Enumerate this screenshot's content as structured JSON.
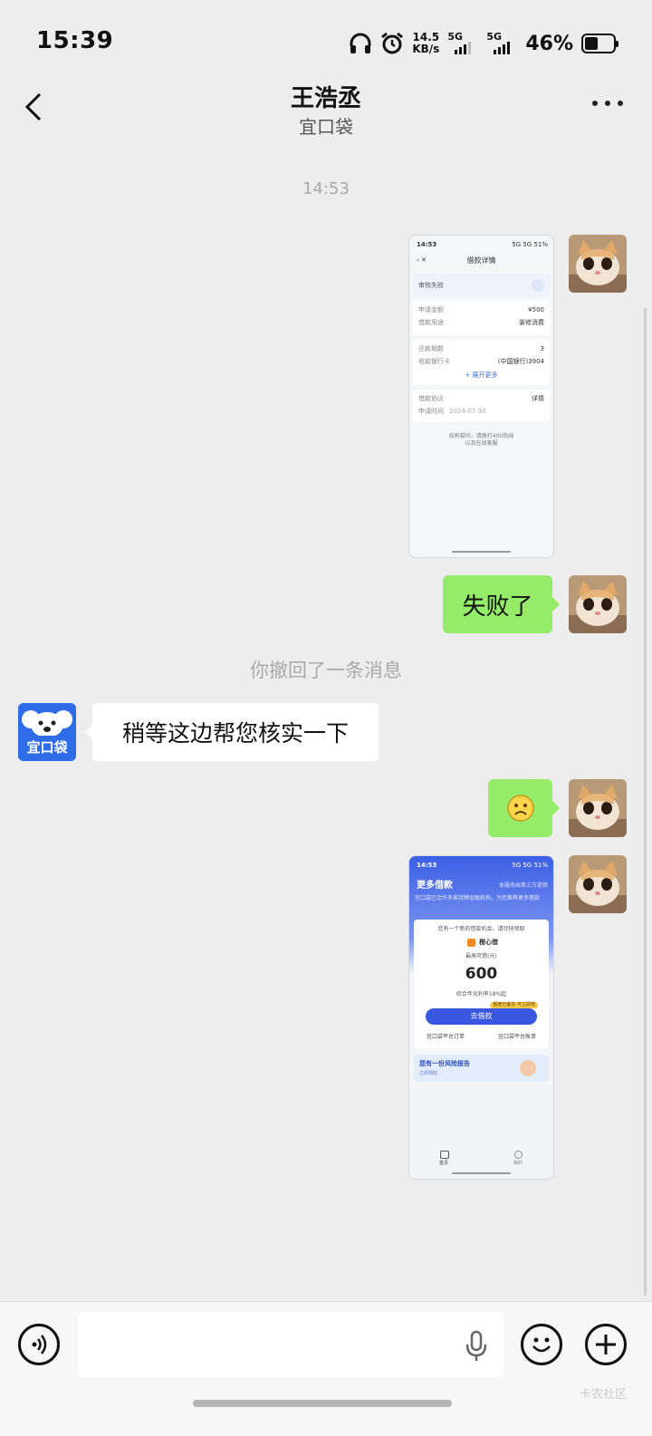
{
  "status_bar": {
    "time": "15:39",
    "net_speed_value": "14.5",
    "net_speed_unit": "KB/s",
    "sim1": "5G",
    "sim2": "5G",
    "battery_percent": "46%",
    "battery_level": 0.46
  },
  "header": {
    "title": "王浩丞",
    "subtitle": "宜口袋"
  },
  "chat": {
    "timestamp": "14:53",
    "recall_notice": "你撤回了一条消息",
    "messages": [
      {
        "type": "image",
        "from": "me"
      },
      {
        "type": "text",
        "from": "me",
        "text": "失败了"
      },
      {
        "type": "text",
        "from": "other",
        "text": "稍等这边帮您核实一下"
      },
      {
        "type": "emoji",
        "from": "me",
        "emoji": "☹"
      },
      {
        "type": "image",
        "from": "me"
      }
    ]
  },
  "other_avatar": {
    "text": "宜口袋",
    "color": "#2f6de8"
  },
  "shot1": {
    "time": "14:53",
    "status": "5G 5G 51%",
    "title": "借款详情",
    "badge": "审核失败",
    "row1_label": "申请金额",
    "row1_value": "¥500",
    "row2_label": "借款用途",
    "row2_value": "装修消费",
    "row3_label": "还款期数",
    "row3_value": "3",
    "row4_label": "收款银行卡",
    "row4_value": "(中国银行)3904",
    "expand": "+ 展开更多",
    "row5_label": "借款协议",
    "row5_value": "详情",
    "row6_label": "申请时间",
    "row6_value": "2024-07-30",
    "footer1": "如有疑问，请拨打400热线",
    "footer2": "以及在线客服"
  },
  "shot2": {
    "time": "14:53",
    "status": "5G 5G 51%",
    "title": "更多借款",
    "top_right": "本服务由第三方提供",
    "notice": "宜口袋已合作多家持牌金融机构，为您推荐更多借款",
    "intro": "您有一个新的借款机会，请尽快领取",
    "product": "橙心借",
    "limit_label": "最高可借(元)",
    "amount": "600",
    "rate": "综合年化利率18%起",
    "tag": "额度已备好 可立即借",
    "button": "去借款",
    "link_left": "宜口袋平台订单",
    "link_right": "宜口袋平台账单",
    "banner_title": "您有一份风险报告",
    "banner_sub": "立即领取",
    "nav_home": "首页",
    "nav_mine": "我的"
  },
  "watermark": "卡农社区"
}
